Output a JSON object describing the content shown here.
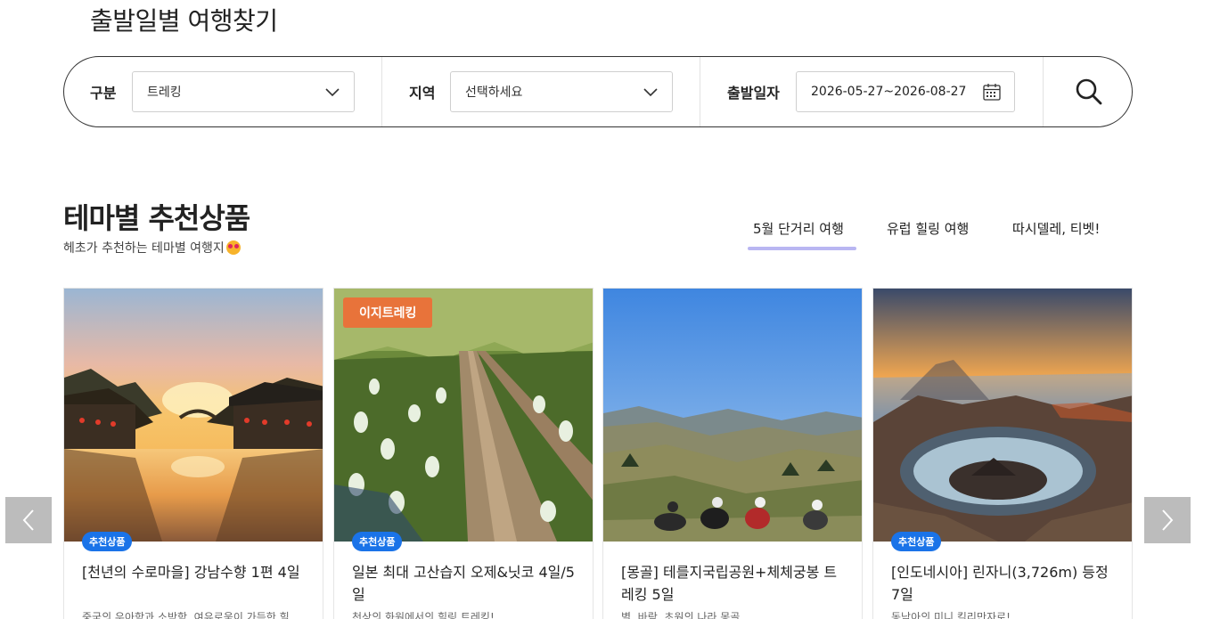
{
  "page": {
    "title": "출발일별 여행찾기"
  },
  "search": {
    "category_label": "구분",
    "category_value": "트레킹",
    "region_label": "지역",
    "region_value": "선택하세요",
    "date_label": "출발일자",
    "date_value": "2026-05-27~2026-08-27",
    "icons": {
      "chevron": "chevron-down-icon",
      "calendar": "calendar-icon",
      "search": "search-icon"
    }
  },
  "theme": {
    "title": "테마별 추천상품",
    "subtitle": "헤초가 추천하는 테마별 여행지",
    "subtitle_icon": "heart-eyes-emoji-icon",
    "tabs": [
      {
        "label": "5월 단거리 여행",
        "active": true
      },
      {
        "label": "유럽 힐링 여행",
        "active": false
      },
      {
        "label": "따시델레, 티벳!",
        "active": false
      }
    ],
    "accent_color": "#b9b6f2"
  },
  "cards": [
    {
      "badge": "추천상품",
      "tag": "",
      "title": "[천년의 수로마을] 강남수향 1편 4일",
      "desc": "중국의 우아함과 소박함, 여유로움이 가득한 힐",
      "image": "water-town-sunset"
    },
    {
      "badge": "추천상품",
      "tag": "이지트레킹",
      "title": "일본 최대 고산습지 오제&닛코 4일/5일",
      "desc": "천상의 화원에서의 힐링 트레킹!",
      "image": "marsh-boardwalk"
    },
    {
      "badge": "",
      "tag": "",
      "title": "[몽골] 테를지국립공원+체체궁봉 트레킹 5일",
      "desc": "별, 바람, 초원의 나라 몽골",
      "image": "mongolia-hills"
    },
    {
      "badge": "추천상품",
      "tag": "",
      "title": "[인도네시아] 린자니(3,726m) 등정 7일",
      "desc": "동남아의 미니 킬리만자로!",
      "image": "volcano-crater-lake"
    }
  ],
  "carousel": {
    "prev_icon": "chevron-left-icon",
    "next_icon": "chevron-right-icon"
  },
  "colors": {
    "badge_blue": "#1a73e8",
    "tag_orange": "#e8733a"
  }
}
